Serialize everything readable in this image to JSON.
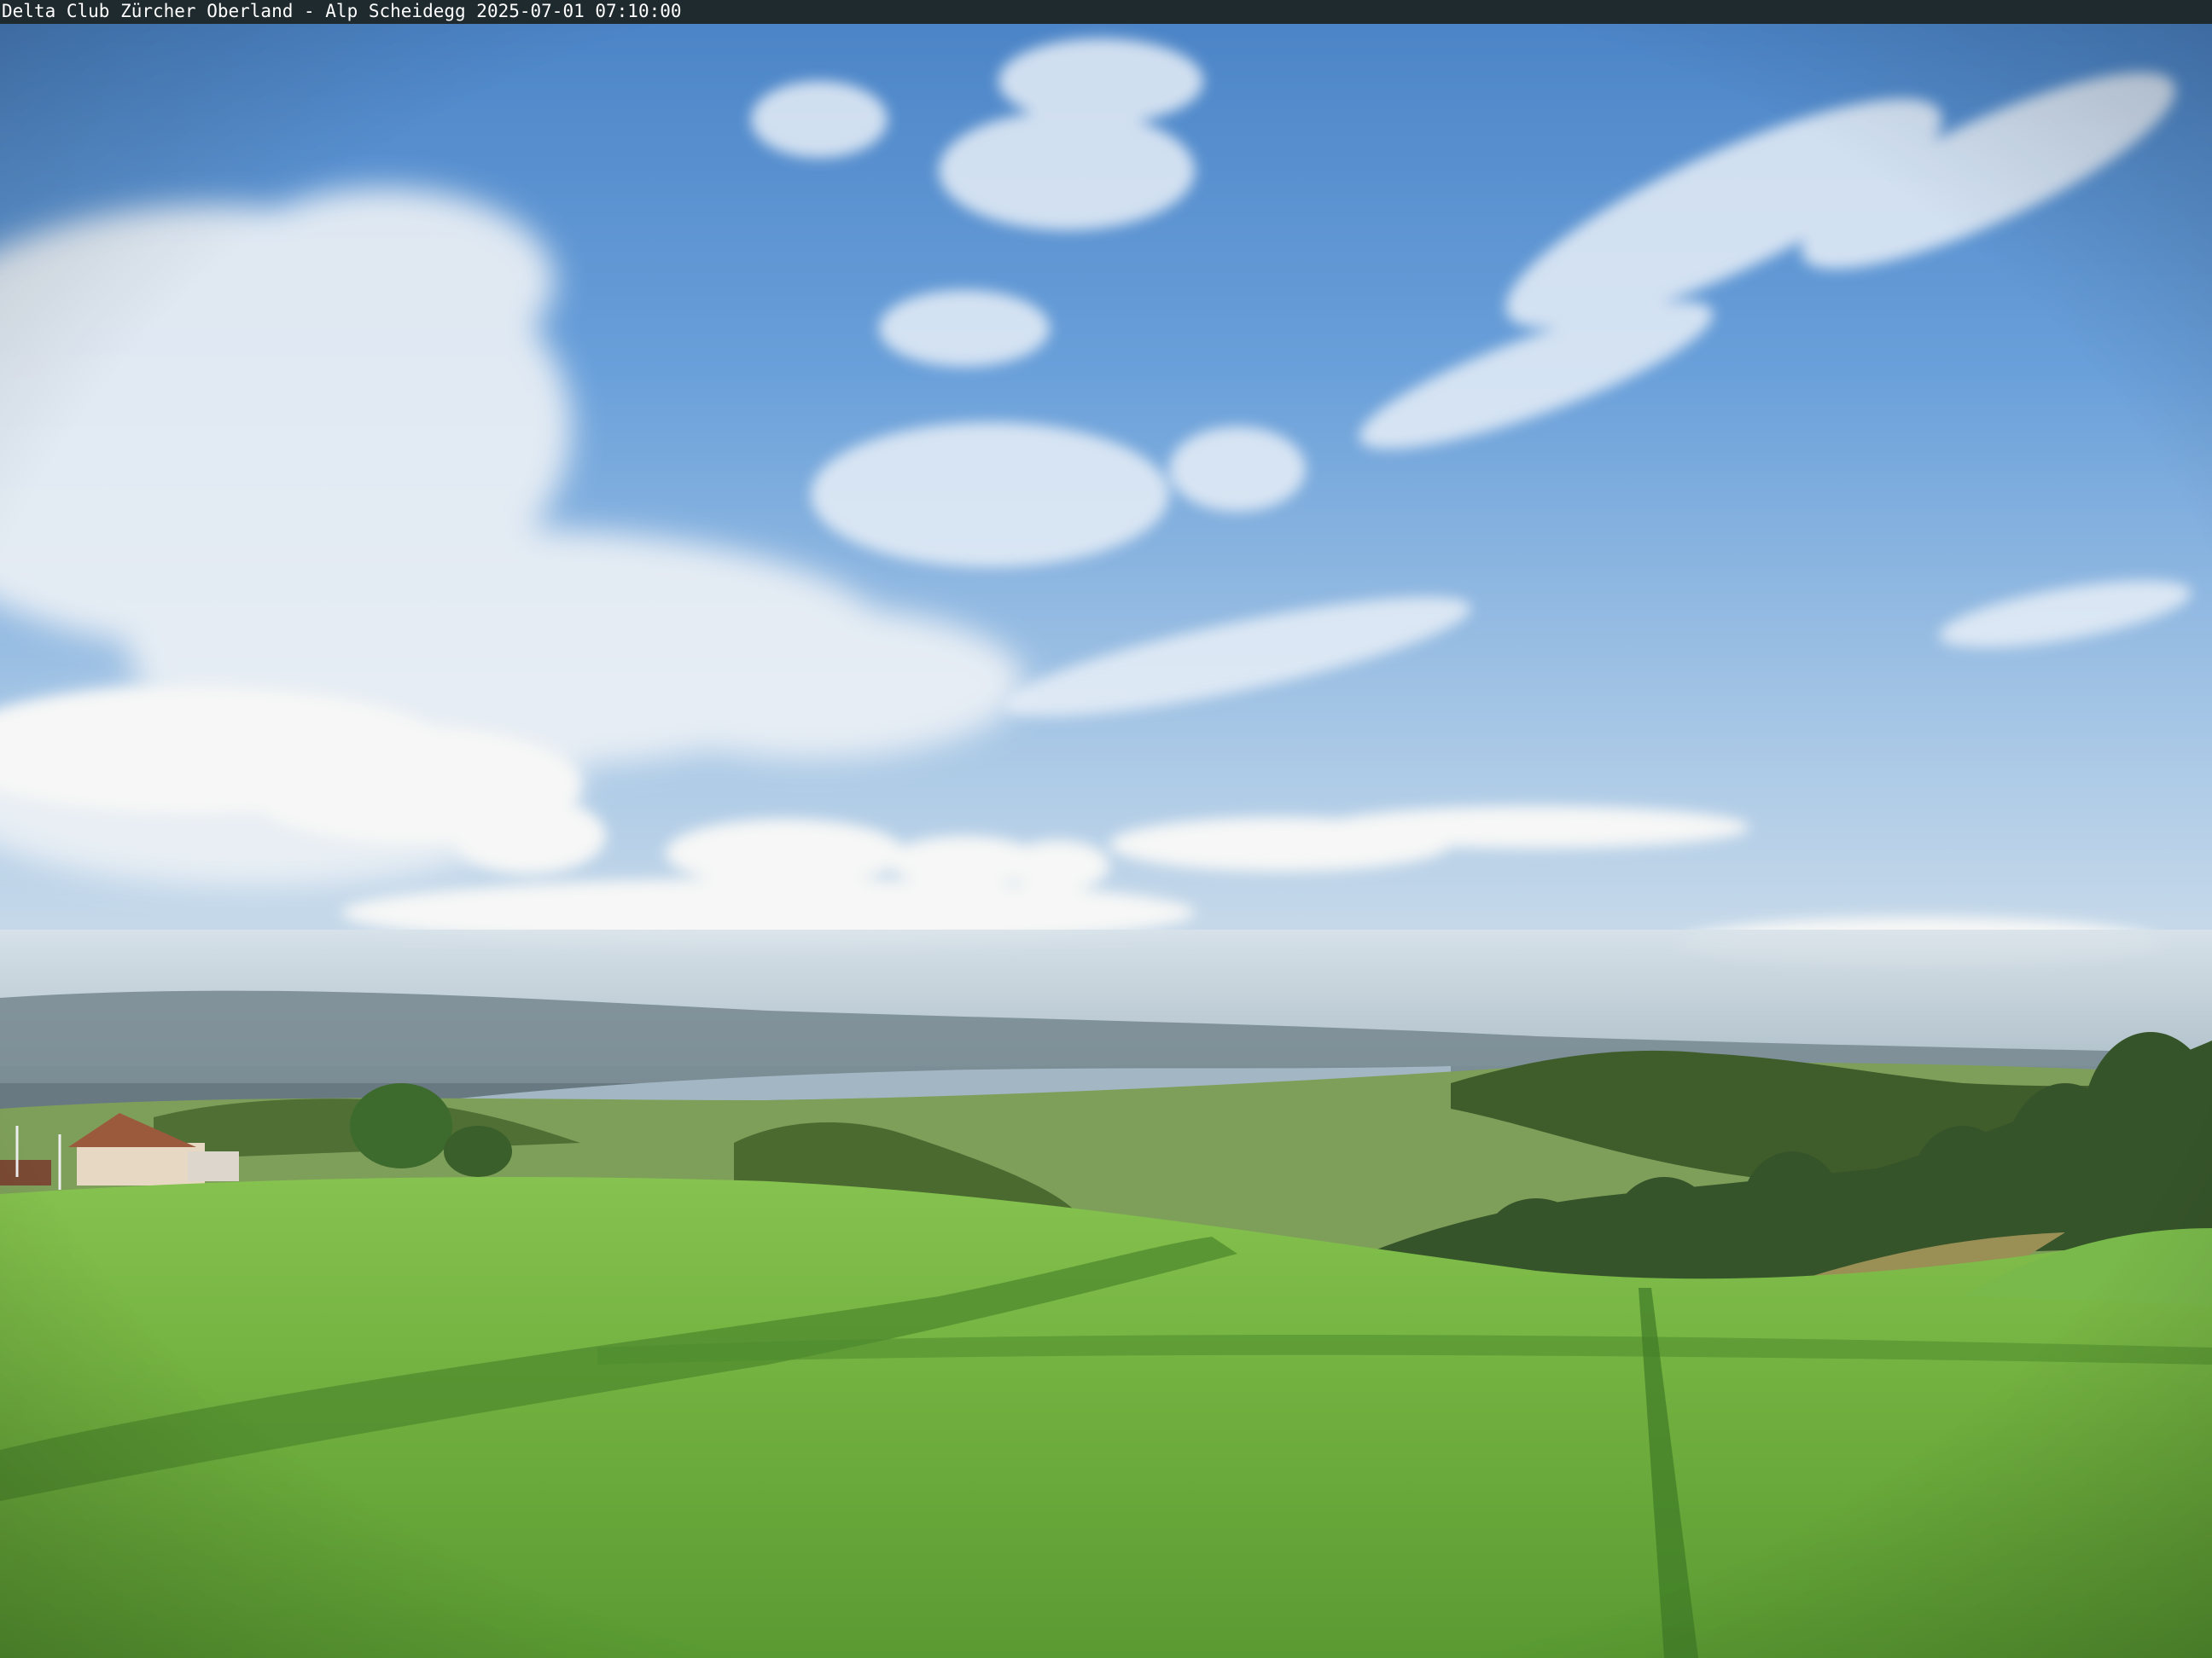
{
  "webcam": {
    "caption": "Delta Club Zürcher Oberland - Alp Scheidegg 2025-07-01 07:10:00"
  },
  "scene": {
    "description_tags": [
      "sky",
      "clouds",
      "hills",
      "lake",
      "meadow",
      "forest",
      "farmhouse"
    ],
    "colors": {
      "sky_top": "#4d86c9",
      "sky_mid": "#7eafe0",
      "sky_horizon": "#d4e1ea",
      "haze": "#b9c8cf",
      "far_hills": "#6e8590",
      "lake": "#9fb5c2",
      "mid_valley": "#7d9a5a",
      "forest": "#3e5a2a",
      "meadow_light": "#7fbe4a",
      "meadow_dark": "#5f9a35",
      "shadow": "#3f7a27",
      "roof": "#9b5a3c",
      "house_wall": "#e9ddc8"
    }
  }
}
